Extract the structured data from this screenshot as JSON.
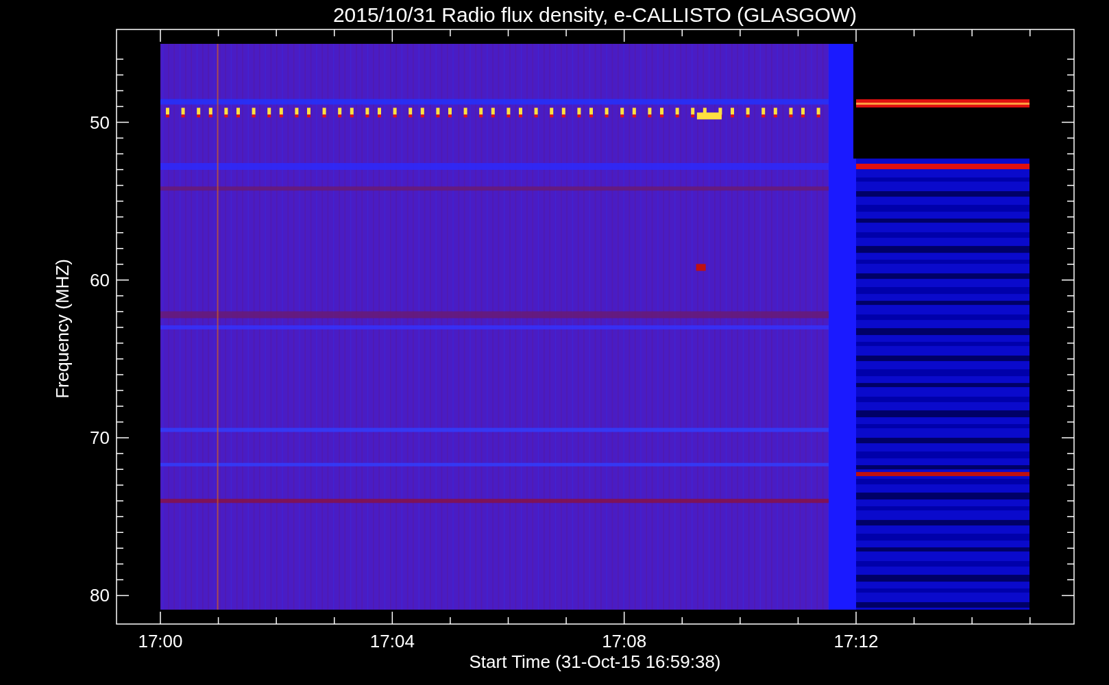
{
  "title": "2015/10/31  Radio flux density, e-CALLISTO (GLASGOW)",
  "y_axis": {
    "label": "Frequency (MHZ)",
    "ticks": [
      "50",
      "60",
      "70",
      "80"
    ]
  },
  "x_axis": {
    "label": "Start Time (31-Oct-15 16:59:38)",
    "ticks": [
      "17:00",
      "17:04",
      "17:08",
      "17:12"
    ]
  }
}
